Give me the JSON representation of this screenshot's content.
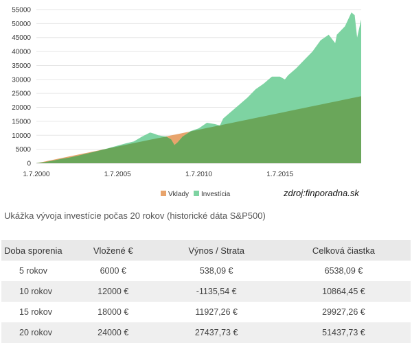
{
  "chart_data": {
    "type": "area",
    "x_ticks": [
      "1.7.2000",
      "1.7.2005",
      "1.7.2010",
      "1.7.2015"
    ],
    "y_ticks": [
      0,
      5000,
      10000,
      15000,
      20000,
      25000,
      30000,
      35000,
      40000,
      45000,
      50000,
      55000
    ],
    "ylim": [
      0,
      55000
    ],
    "xlim": [
      2000.5,
      2020.5
    ],
    "legend": [
      "Vklady",
      "Investícia"
    ],
    "legend_position": "bottom",
    "grid": "horizontal",
    "series": [
      {
        "name": "Vklady",
        "color": "#e8a46c",
        "x": [
          2000.5,
          2020.5
        ],
        "values": [
          0,
          24000
        ]
      },
      {
        "name": "Investícia",
        "color": "#7ed3a2",
        "x": [
          2000.5,
          2001.0,
          2001.5,
          2002.0,
          2002.5,
          2003.0,
          2003.5,
          2004.0,
          2004.5,
          2005.0,
          2005.5,
          2006.0,
          2006.5,
          2007.0,
          2007.5,
          2007.8,
          2008.0,
          2008.5,
          2008.8,
          2009.0,
          2009.2,
          2009.5,
          2010.0,
          2010.5,
          2011.0,
          2011.5,
          2011.8,
          2012.0,
          2012.5,
          2013.0,
          2013.5,
          2014.0,
          2014.5,
          2015.0,
          2015.5,
          2015.8,
          2016.0,
          2016.5,
          2017.0,
          2017.5,
          2018.0,
          2018.5,
          2018.9,
          2019.0,
          2019.5,
          2019.9,
          2020.1,
          2020.25,
          2020.5
        ],
        "values": [
          0,
          400,
          900,
          1500,
          2000,
          2600,
          3300,
          4000,
          4700,
          5500,
          6300,
          7100,
          7800,
          9500,
          11000,
          10500,
          10000,
          9500,
          8500,
          6500,
          7500,
          9500,
          11500,
          12500,
          14500,
          14000,
          13500,
          16000,
          18500,
          21000,
          23500,
          26500,
          28500,
          31000,
          31000,
          30000,
          31500,
          34000,
          37000,
          40000,
          44000,
          46000,
          43000,
          46000,
          49000,
          54000,
          53000,
          45000,
          51500
        ]
      }
    ]
  },
  "chart_text": {
    "legend_vklady": "Vklady",
    "legend_investicia": "Investícia"
  },
  "source": "zdroj:finporadna.sk",
  "caption": "Ukážka vývoja investície počas 20 rokov (historické dáta S&P500)",
  "table": {
    "headers": [
      "Doba sporenia",
      "Vložené €",
      "Výnos / Strata",
      "Celková čiastka"
    ],
    "rows": [
      [
        "5 rokov",
        "6000 €",
        "538,09 €",
        "6538,09 €"
      ],
      [
        "10 rokov",
        "12000 €",
        "-1135,54 €",
        "10864,45 €"
      ],
      [
        "15 rokov",
        "18000 €",
        "11927,26 €",
        "29927,26 €"
      ],
      [
        "20 rokov",
        "24000 €",
        "27437,73 €",
        "51437,73 €"
      ]
    ]
  },
  "colors": {
    "overlap_green": "#6aa65a",
    "deposit_orange": "#e8a46c",
    "investment_green": "#7ed3a2"
  }
}
